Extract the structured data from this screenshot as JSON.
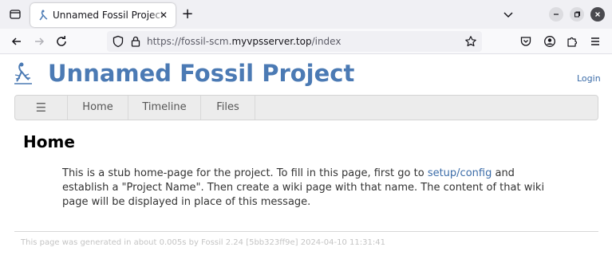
{
  "browser": {
    "tab": {
      "title": "Unnamed Fossil Project: Home"
    },
    "url": {
      "prefix": "https://fossil-scm.",
      "host": "myvpsserver.top",
      "suffix": "/index"
    }
  },
  "site": {
    "title": "Unnamed Fossil Project",
    "login": "Login"
  },
  "menu": {
    "hamburger": "☰",
    "items": [
      {
        "label": "Home"
      },
      {
        "label": "Timeline"
      },
      {
        "label": "Files"
      }
    ]
  },
  "content": {
    "heading": "Home",
    "text_before": "This is a stub home-page for the project. To fill in this page, first go to ",
    "link": "setup/config",
    "text_after": " and establish a \"Project Name\". Then create a wiki page with that name. The content of that wiki page will be displayed in place of this message."
  },
  "footer": {
    "text": "This page was generated in about 0.005s by Fossil 2.24 [5bb323ff9e] 2024-04-10 11:31:41"
  },
  "colors": {
    "title": "#4b7ab4",
    "link": "#3b6ca8"
  }
}
